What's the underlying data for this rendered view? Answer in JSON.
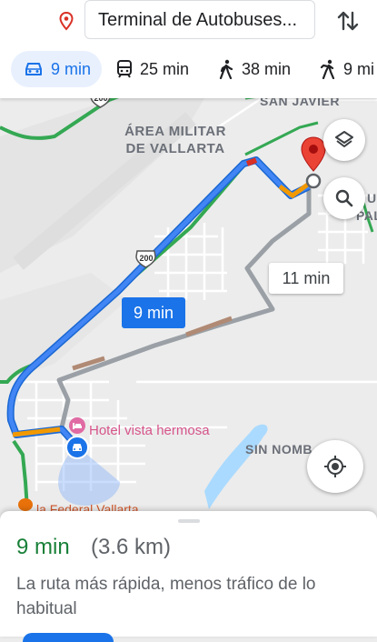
{
  "header": {
    "destination": "Terminal de Autobuses...",
    "modes": [
      {
        "icon": "car-icon",
        "label": "9 min",
        "active": true
      },
      {
        "icon": "transit-icon",
        "label": "25 min",
        "active": false
      },
      {
        "icon": "walk-icon",
        "label": "38 min",
        "active": false
      },
      {
        "icon": "ride-icon",
        "label": "9 mi",
        "active": false
      }
    ]
  },
  "map": {
    "labels": {
      "area_line1": "ÁREA MILITAR",
      "area_line2": "DE VALLARTA",
      "san_javier": "SAN JAVIER",
      "sin_nombre": "SIN NOMB",
      "right_u": "U",
      "right_palm": "PALM",
      "hotel": "Hotel vista hermosa",
      "place": "la Federal Vallarta"
    },
    "highway_shields": [
      "200",
      "200"
    ],
    "route_eta_selected": "9 min",
    "route_eta_alt": "11 min"
  },
  "summary": {
    "time": "9 min",
    "distance": "(3.6 km)",
    "description": "La ruta más rápida, menos tráfico de lo habitual"
  },
  "colors": {
    "route_blue": "#1a73e8",
    "route_alt": "#9aa0a6",
    "traffic_green": "#34a853",
    "traffic_orange": "#f29900",
    "traffic_red": "#d93025",
    "eta_green": "#188038"
  }
}
